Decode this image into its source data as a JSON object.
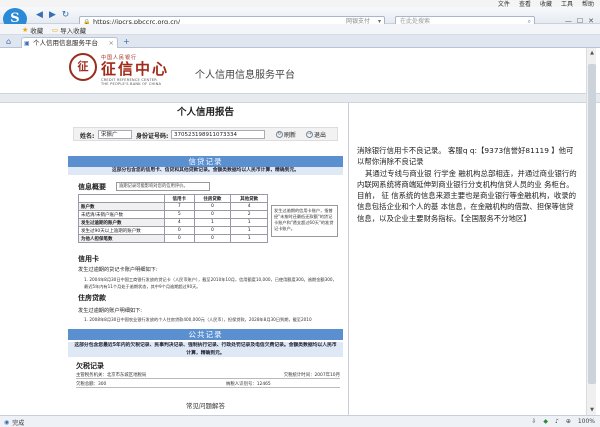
{
  "browser": {
    "menus": [
      "文件",
      "查看",
      "收藏",
      "工具",
      "帮助"
    ],
    "address": "https://ipcrs.pbccrc.org.cn/",
    "address_hint": "网银支付",
    "search_placeholder": "在此处搜索",
    "favorites": [
      "收藏",
      "导入收藏"
    ],
    "tab_title": "个人信用信息服务平台",
    "status_left": "完成",
    "zoom": "100%"
  },
  "site": {
    "seal_char": "征",
    "brand_top": "中国人民银行",
    "brand_main": "征信中心",
    "brand_en1": "CREDIT REFERENCE CENTER",
    "brand_en2": "THE PEOPLE'S BANK OF CHINA",
    "service_title": "个人信用信息服务平台"
  },
  "report": {
    "title": "个人信用报告",
    "name_label": "姓名:",
    "name_value": "宋振广",
    "id_label": "身份证号码:",
    "id_value": "370523198911073334",
    "refresh": "刷新",
    "exit": "退出",
    "credit_section": "信贷记录",
    "credit_note": "这部分包含您的信用卡、信贷和其他贷款记录。金额类数据均以人民币计算，精确到元。",
    "summary_heading": "信息概要",
    "summary_hint": "逾期记录可能影响对您的信用评价。",
    "summary_table": {
      "headers": [
        "",
        "信用卡",
        "住房贷款",
        "其他贷款"
      ],
      "rows": [
        {
          "label": "账户数",
          "values": [
            "7",
            "0",
            "4"
          ],
          "dark": true
        },
        {
          "label": "未结清/未销户账户数",
          "values": [
            "5",
            "0",
            "2"
          ],
          "dark": false
        },
        {
          "label": "发生过逾期的账户数",
          "values": [
            "4",
            "1",
            "1"
          ],
          "dark": true
        },
        {
          "label": "发生过90天以上逾期的账户数",
          "values": [
            "0",
            "0",
            "1"
          ],
          "dark": false
        },
        {
          "label": "为他人担保笔数",
          "values": [
            "0",
            "0",
            "1"
          ],
          "dark": true
        }
      ]
    },
    "sidebox_text": "发生过逾期的信用卡账户，指曾经\"未按时还最低还款额\"的贷记卡账户和\"透支超过60天\"的准贷记卡账户。",
    "credit_card_heading": "信用卡",
    "credit_card_intro": "发生过逾期的贷记卡账户明细如下:",
    "credit_card_detail": "1. 2004年8月30日中国工商银行发放的贷记卡（人民币账户），截至2010年10月，信用额度10,000，已使用额度300。逾期金额300，最近5年内有11个月处于逾期状态，其中9个月逾期超过90天。",
    "housing_heading": "住房贷款",
    "housing_intro": "发生过逾期的账户明细如下:",
    "housing_detail": "1. 2008年8月30日中国农业银行发放的个人住房贷款400,000元（人民币），担保贷款，2028年8月30日到期，截至2010",
    "public_section": "公共记录",
    "public_note": "这部分包含您最近5年内的欠税记录、民事判决记录、强制执行记录、行政处罚记录及电信欠费记录。金额类数据均以人民币计算，精确到元。",
    "tax_heading": "欠税记录",
    "tax_row1_left": "主管税务机关：北京市东城区地税局",
    "tax_row1_right": "欠税统计时间：2007年10月",
    "tax_row2_left": "欠税总额：300",
    "tax_row2_mid": "纳税人识别号：12465",
    "faq": "常见问题解答"
  },
  "side_text": {
    "line1": "消除银行信用卡不良记录。 客服q q:【9373信誉好81119 】他可以帮你消除不良记录",
    "line2": "其通过专线与商业银 行学金 融机构总部相连，并通过商业银行的内联网系统将商端延伸到商业银行分支机构信贷人员的业 务柜台。目前， 征 信系统的信息来源主要也是商业银行等金融机构，收录的信息包括企业和个人的基 本信息，在金融机构的借款、担保等信贷信息，以及企业主要财务指标。【全国服务不分地区】"
  }
}
